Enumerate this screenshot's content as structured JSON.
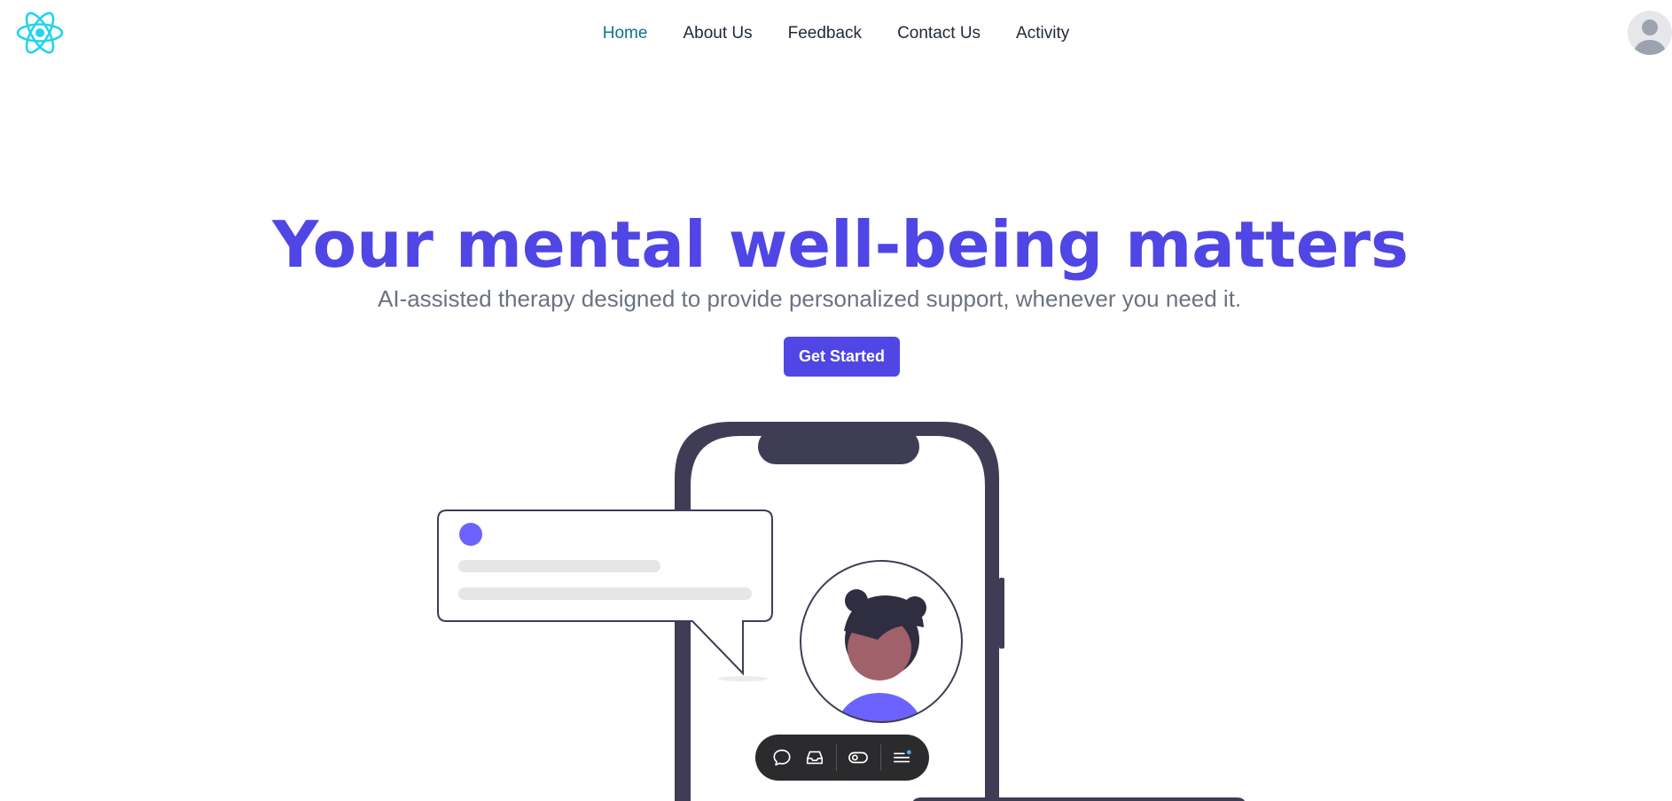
{
  "nav": {
    "items": [
      {
        "label": "Home",
        "active": true
      },
      {
        "label": "About Us"
      },
      {
        "label": "Feedback"
      },
      {
        "label": "Contact Us"
      },
      {
        "label": "Activity"
      }
    ]
  },
  "hero": {
    "title": "Your mental well-being matters",
    "subtitle": "AI-assisted therapy designed to provide personalized support, whenever you need it.",
    "cta_label": "Get Started"
  },
  "icons": {
    "logo": "react-logo-icon",
    "avatar": "user-avatar-icon",
    "toolbar": [
      "chat-bubble-icon",
      "inbox-icon",
      "toggle-icon",
      "menu-notification-icon"
    ]
  },
  "colors": {
    "accent": "#4f46e5",
    "active_nav": "#0e7490",
    "logo": "#22d3ee",
    "illustration_dark": "#3f3d56",
    "illustration_purple": "#6c63ff"
  }
}
